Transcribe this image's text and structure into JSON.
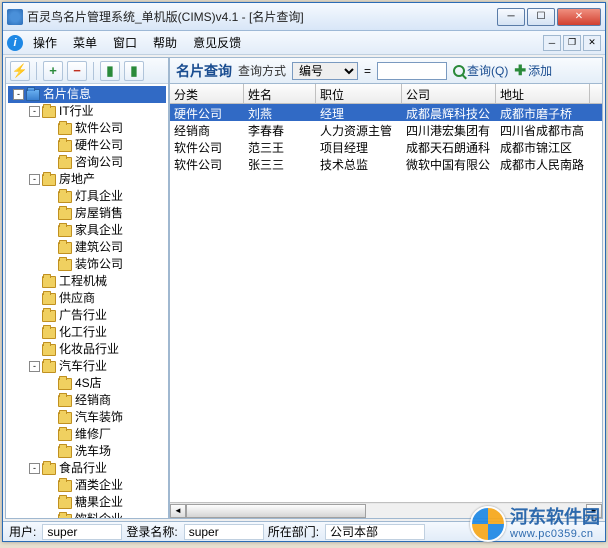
{
  "window": {
    "title": "百灵鸟名片管理系统_单机版(CIMS)v4.1 - [名片查询]"
  },
  "menu": {
    "items": [
      "操作",
      "菜单",
      "窗口",
      "帮助",
      "意见反馈"
    ]
  },
  "toolbar": {
    "buttons": [
      {
        "name": "lightning",
        "glyph": "⚡",
        "color": "#d9a400"
      },
      {
        "name": "add",
        "glyph": "+",
        "color": "#2a8a3a"
      },
      {
        "name": "remove",
        "glyph": "−",
        "color": "#c03020"
      },
      {
        "name": "save",
        "glyph": "▮",
        "color": "#2a8a3a"
      },
      {
        "name": "export",
        "glyph": "▮",
        "color": "#2a8a3a"
      }
    ]
  },
  "tree": {
    "root": "名片信息",
    "nodes": [
      {
        "d": 1,
        "t": "-",
        "label": "IT行业"
      },
      {
        "d": 2,
        "label": "软件公司"
      },
      {
        "d": 2,
        "label": "硬件公司"
      },
      {
        "d": 2,
        "label": "咨询公司"
      },
      {
        "d": 1,
        "t": "-",
        "label": "房地产"
      },
      {
        "d": 2,
        "label": "灯具企业"
      },
      {
        "d": 2,
        "label": "房屋销售"
      },
      {
        "d": 2,
        "label": "家具企业"
      },
      {
        "d": 2,
        "label": "建筑公司"
      },
      {
        "d": 2,
        "label": "装饰公司"
      },
      {
        "d": 1,
        "label": "工程机械"
      },
      {
        "d": 1,
        "label": "供应商"
      },
      {
        "d": 1,
        "label": "广告行业"
      },
      {
        "d": 1,
        "label": "化工行业"
      },
      {
        "d": 1,
        "label": "化妆品行业"
      },
      {
        "d": 1,
        "t": "-",
        "label": "汽车行业"
      },
      {
        "d": 2,
        "label": "4S店"
      },
      {
        "d": 2,
        "label": "经销商"
      },
      {
        "d": 2,
        "label": "汽车装饰"
      },
      {
        "d": 2,
        "label": "维修厂"
      },
      {
        "d": 2,
        "label": "洗车场"
      },
      {
        "d": 1,
        "t": "-",
        "label": "食品行业"
      },
      {
        "d": 2,
        "label": "酒类企业"
      },
      {
        "d": 2,
        "label": "糖果企业"
      },
      {
        "d": 2,
        "label": "饮料企业"
      }
    ]
  },
  "query": {
    "title": "名片查询",
    "mode_label": "查询方式",
    "mode_value": "编号",
    "eq": "=",
    "value": "",
    "search_btn": "查询(Q)",
    "add_btn": "添加"
  },
  "grid": {
    "columns": [
      "分类",
      "姓名",
      "职位",
      "公司",
      "地址"
    ],
    "rows": [
      {
        "sel": true,
        "cells": [
          "硬件公司",
          "刘燕",
          "经理",
          "成都晨辉科技公",
          "成都市磨子桥"
        ]
      },
      {
        "cells": [
          "经销商",
          "李春春",
          "人力资源主管",
          "四川港宏集团有",
          "四川省成都市高"
        ]
      },
      {
        "cells": [
          "软件公司",
          "范三王",
          "项目经理",
          "成都天石朗通科",
          "成都市锦江区"
        ]
      },
      {
        "cells": [
          "软件公司",
          "张三三",
          "技术总监",
          "微软中国有限公",
          "成都市人民南路"
        ]
      }
    ]
  },
  "status": {
    "user_label": "用户:",
    "user": "super",
    "login_label": "登录名称:",
    "login": "super",
    "dept_label": "所在部门:",
    "dept": "公司本部"
  },
  "watermark": {
    "top": "河东软件园",
    "bot": "www.pc0359.cn"
  }
}
